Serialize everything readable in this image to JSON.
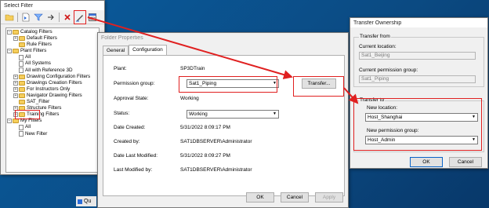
{
  "select_filter": {
    "title": "Select Filter",
    "tree": [
      {
        "label": "Catalog Filters",
        "level": 0,
        "expander": "minus",
        "icon": "folder"
      },
      {
        "label": "Default Filters",
        "level": 1,
        "expander": "plus",
        "icon": "folder"
      },
      {
        "label": "Rule Filters",
        "level": 1,
        "expander": "none",
        "icon": "folder"
      },
      {
        "label": "Plant Filters",
        "level": 0,
        "expander": "minus",
        "icon": "folder"
      },
      {
        "label": "All",
        "level": 1,
        "expander": "none",
        "icon": "leaf"
      },
      {
        "label": "All Systems",
        "level": 1,
        "expander": "none",
        "icon": "leaf"
      },
      {
        "label": "All with Reference 3D",
        "level": 1,
        "expander": "none",
        "icon": "leaf"
      },
      {
        "label": "Drawing Configuration Filters",
        "level": 1,
        "expander": "plus",
        "icon": "folder"
      },
      {
        "label": "Drawings Creation Filters",
        "level": 1,
        "expander": "plus",
        "icon": "folder"
      },
      {
        "label": "For Instructors Only",
        "level": 1,
        "expander": "plus",
        "icon": "folder"
      },
      {
        "label": "Navigator Drawing Filters",
        "level": 1,
        "expander": "plus",
        "icon": "folder"
      },
      {
        "label": "SAT_Filter",
        "level": 1,
        "expander": "none",
        "icon": "folder"
      },
      {
        "label": "Structure Filters",
        "level": 1,
        "expander": "plus",
        "icon": "folder"
      },
      {
        "label": "Training Filters",
        "level": 1,
        "expander": "plus",
        "icon": "folder"
      },
      {
        "label": "My Filters",
        "level": 0,
        "expander": "minus",
        "icon": "folder"
      },
      {
        "label": "All",
        "level": 1,
        "expander": "none",
        "icon": "leaf"
      },
      {
        "label": "New Filter",
        "level": 1,
        "expander": "none",
        "icon": "leaf"
      }
    ]
  },
  "folder_props": {
    "title": "Folder Properties",
    "tabs": [
      "General",
      "Configuration"
    ],
    "plant_label": "Plant:",
    "plant_value": "SP3DTrain",
    "perm_group_label": "Permission group:",
    "perm_group_value": "Sat1_Piping",
    "transfer_label": "Transfer...",
    "approval_label": "Approval State:",
    "approval_value": "Working",
    "status_label": "Status:",
    "status_value": "Working",
    "date_created_label": "Date Created:",
    "date_created_value": "5/31/2022 8:09:17 PM",
    "created_by_label": "Created by:",
    "created_by_value": "SAT1DBSERVER\\Administrator",
    "date_modified_label": "Date Last Modified:",
    "date_modified_value": "5/31/2022 8:09:27 PM",
    "modified_by_label": "Last Modified by:",
    "modified_by_value": "SAT1DBSERVER\\Administrator",
    "ok_label": "OK",
    "cancel_label": "Cancel",
    "apply_label": "Apply"
  },
  "transfer": {
    "title": "Transfer Ownership",
    "from_group": "Transfer from",
    "current_location_label": "Current location:",
    "current_location_value": "Sat1_Beijing",
    "current_perm_label": "Current permission group:",
    "current_perm_value": "Sat1_Piping",
    "to_group": "Transfer to",
    "new_location_label": "New location:",
    "new_location_value": "Host_Shanghai",
    "new_perm_label": "New permission group:",
    "new_perm_value": "Host_Admin",
    "ok_label": "OK",
    "cancel_label": "Cancel"
  },
  "taskbar": {
    "label": "Qu"
  },
  "colors": {
    "highlight": "#e02020",
    "folder": "#f5cd5b",
    "desktop": "#0a4f8a"
  }
}
